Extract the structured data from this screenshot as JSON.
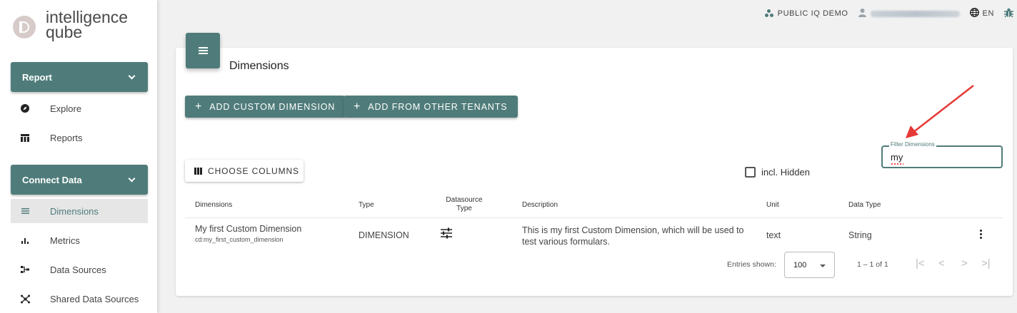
{
  "app": {
    "logo_line1": "intelligence",
    "logo_line2": "qube"
  },
  "topbar": {
    "workspace": "PUBLIC IQ DEMO",
    "language": "EN"
  },
  "sidebar": {
    "report_section": "Report",
    "report_items": [
      {
        "label": "Explore",
        "icon": "compass-icon"
      },
      {
        "label": "Reports",
        "icon": "table-icon"
      }
    ],
    "connect_section": "Connect Data",
    "connect_items": [
      {
        "label": "Dimensions",
        "icon": "list-icon",
        "active": true
      },
      {
        "label": "Metrics",
        "icon": "bar-chart-icon"
      },
      {
        "label": "Data Sources",
        "icon": "flow-icon"
      },
      {
        "label": "Shared Data Sources",
        "icon": "hub-icon"
      }
    ]
  },
  "page": {
    "title": "Dimensions",
    "add_custom_label": "ADD CUSTOM DIMENSION",
    "add_tenants_label": "ADD FROM OTHER TENANTS",
    "choose_columns_label": "CHOOSE COLUMNS",
    "incl_hidden_label": "incl. Hidden",
    "incl_hidden_checked": false,
    "filter_label": "Filter Dimensions",
    "filter_value": "my"
  },
  "table": {
    "headers": {
      "dimensions": "Dimensions",
      "type": "Type",
      "datasource_line1": "Datasource",
      "datasource_line2": "Type",
      "description": "Description",
      "unit": "Unit",
      "data_type": "Data Type"
    },
    "rows": [
      {
        "name": "My first Custom Dimension",
        "id": "cd:my_first_custom_dimension",
        "type": "DIMENSION",
        "datasource_icon": "tune-icon",
        "description_line1": "This is my first Custom Dimension, which will be used to",
        "description_line2": "test various formulars.",
        "unit": "text",
        "data_type": "String"
      }
    ]
  },
  "pagination": {
    "entries_label": "Entries shown:",
    "entries_value": "100",
    "range": "1 – 1 of 1"
  },
  "colors": {
    "accent": "#4f7c7a",
    "annotation_arrow": "#e53935"
  }
}
